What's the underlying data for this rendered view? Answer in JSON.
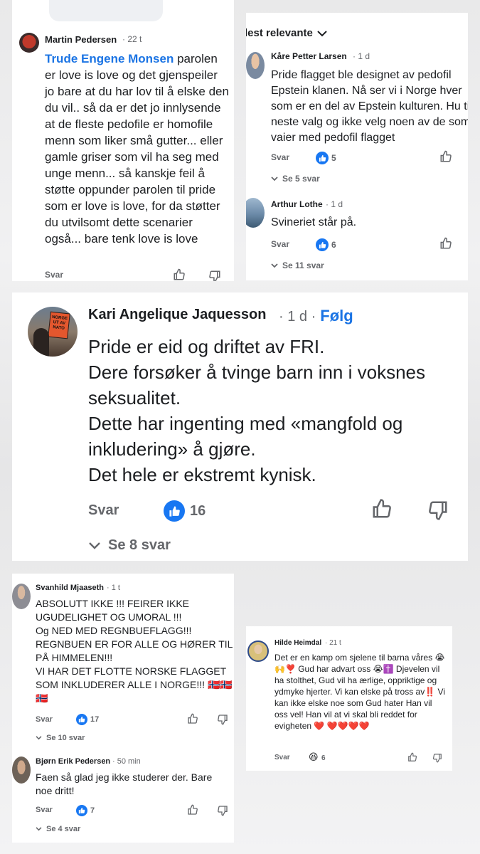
{
  "colors": {
    "link": "#1b74e4",
    "like": "#1877f2",
    "muted": "#65676b",
    "text": "#1c1e21"
  },
  "top_left": {
    "author": "Martin Pedersen",
    "time": "· 22 t",
    "mention": "Trude Engene Monsen",
    "text": " parolen er love is love og det gjenspeiler jo bare at du har lov til å elske den du vil..  så da er det jo innlysende at de fleste pedofile er homofile menn som liker små gutter... eller gamle griser som vil ha seg med unge menn... så kanskje feil å støtte oppunder parolen til pride som er love is love, for da støtter du utvilsomt dette scenarier også... bare tenk love is love",
    "reply_label": "Svar"
  },
  "top_right": {
    "sort_label": "lest relevante",
    "comments": [
      {
        "author": "Kåre Petter Larsen",
        "time": "· 1 d",
        "text": "Pride flagget ble designet av pedofil Epstein klanen. Nå ser vi i Norge hver som er en del av Epstein kulturen. Hu til neste valg og ikke velg noen av de som vaier med pedofil flagget",
        "reply_label": "Svar",
        "likes": "5",
        "replies": "Se 5 svar"
      },
      {
        "author": "Arthur Lothe",
        "time": "· 1 d",
        "text": "Svineriet står på.",
        "reply_label": "Svar",
        "likes": "6",
        "replies": "Se 11 svar"
      }
    ]
  },
  "middle": {
    "author": "Kari Angelique Jaquesson",
    "time": "· 1 d ·",
    "follow": "Følg",
    "avatar_sign": "NORGE UT AV NATO",
    "lines": [
      "Pride er eid og driftet av FRI.",
      "Dere forsøker å tvinge barn inn i voksnes seksualitet.",
      "Dette har ingenting med «mangfold og inkludering» å gjøre.",
      "Det hele er ekstremt kynisk."
    ],
    "reply_label": "Svar",
    "likes": "16",
    "replies": "Se 8 svar"
  },
  "bottom_left": {
    "comments": [
      {
        "author": "Svanhild Mjaaseth",
        "time": "· 1 t",
        "text": "ABSOLUTT IKKE !!! FEIRER IKKE UGUDELIGHET OG UMORAL !!!\nOg NED MED REGNBUEFLAGG!!!\nREGNBUEN ER FOR ALLE OG HØRER TIL PÅ HIMMELEN!!!\nVI HAR DET FLOTTE NORSKE FLAGGET SOM INKLUDERER ALLE I NORGE!!! 🇳🇴🇳🇴🇳🇴",
        "reply_label": "Svar",
        "likes": "17",
        "replies": "Se 10 svar"
      },
      {
        "author": "Bjørn Erik Pedersen",
        "time": "· 50 min",
        "text": "Faen så glad jeg ikke studerer der. Bare noe dritt!",
        "reply_label": "Svar",
        "likes": "7",
        "replies": "Se 4 svar"
      }
    ]
  },
  "bottom_right": {
    "author": "Hilde Heimdal",
    "time": "· 21 t",
    "text": "Det er en kamp om sjelene til barna våres 😭🙌❣️ Gud har advart oss 😭✝️ Djevelen vil ha stolthet, Gud vil ha ærlige, oppriktige og ydmyke hjerter. Vi kan elske på tross av‼️ Vi kan ikke elske noe som Gud hater  Han vil oss vel! Han vil at vi skal bli reddet for evigheten ❤️ ❤️❤️❤️❤️",
    "reply_label": "Svar",
    "reaction_icon": "laughing-emoji",
    "reaction_count": "6"
  }
}
